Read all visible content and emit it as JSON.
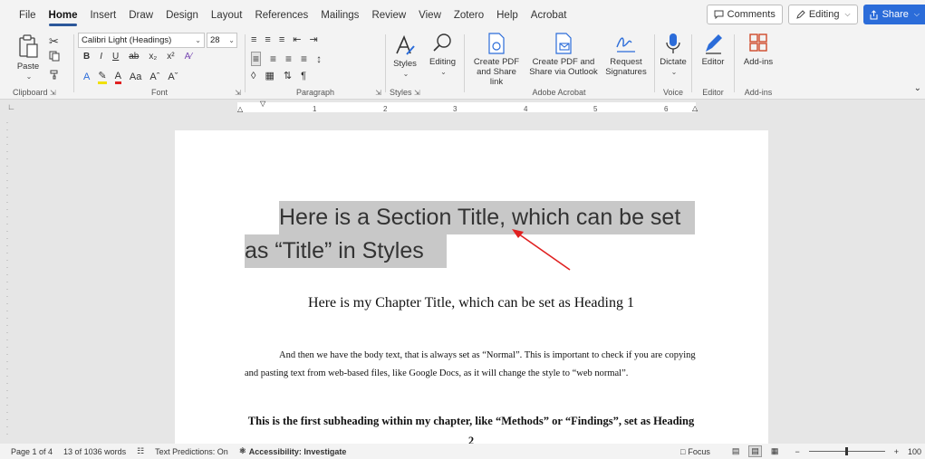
{
  "menu": {
    "tabs": [
      "File",
      "Home",
      "Insert",
      "Draw",
      "Design",
      "Layout",
      "References",
      "Mailings",
      "Review",
      "View",
      "Zotero",
      "Help",
      "Acrobat"
    ],
    "active_tab": "Home",
    "comments_label": "Comments",
    "editing_label": "Editing",
    "share_label": "Share"
  },
  "ribbon": {
    "clipboard": {
      "label": "Clipboard",
      "paste_label": "Paste"
    },
    "font": {
      "label": "Font",
      "font_name": "Calibri Light (Headings)",
      "font_size": "28"
    },
    "paragraph": {
      "label": "Paragraph"
    },
    "styles": {
      "label": "Styles",
      "button": "Styles"
    },
    "editing": {
      "button": "Editing"
    },
    "adobe": {
      "label": "Adobe Acrobat",
      "create_pdf_line1": "Create PDF",
      "create_pdf_line2": "and Share link",
      "create_outlook_line1": "Create PDF and",
      "create_outlook_line2": "Share via Outlook",
      "request_line1": "Request",
      "request_line2": "Signatures"
    },
    "voice": {
      "label": "Voice",
      "button": "Dictate"
    },
    "editor": {
      "label": "Editor",
      "button": "Editor"
    },
    "addins": {
      "label": "Add-ins",
      "button": "Add-ins"
    }
  },
  "ruler": {
    "marks": [
      "1",
      "2",
      "3",
      "4",
      "5",
      "6"
    ]
  },
  "document": {
    "title_line1": "Here is a Section Title, which can be set",
    "title_line2": "as “Title” in Styles",
    "heading1": "Here is my Chapter Title, which can be set as Heading 1",
    "body": "And then we have the body text, that is always set as “Normal”. This is important to check if you are copying and pasting text from web-based files, like Google Docs, as it will change the style to “web normal”.",
    "heading2": "This is the first subheading within my chapter, like “Methods” or “Findings”, set as Heading 2"
  },
  "status": {
    "page": "Page 1 of 4",
    "words": "13 of 1036 words",
    "predictions": "Text Predictions: On",
    "accessibility": "Accessibility: Investigate",
    "focus": "Focus",
    "zoom": "100"
  },
  "colors": {
    "accent": "#2b579a",
    "share_bg": "#2b6cd9",
    "annotation_arrow": "#e02020",
    "title_highlight": "#c8c8c8"
  }
}
